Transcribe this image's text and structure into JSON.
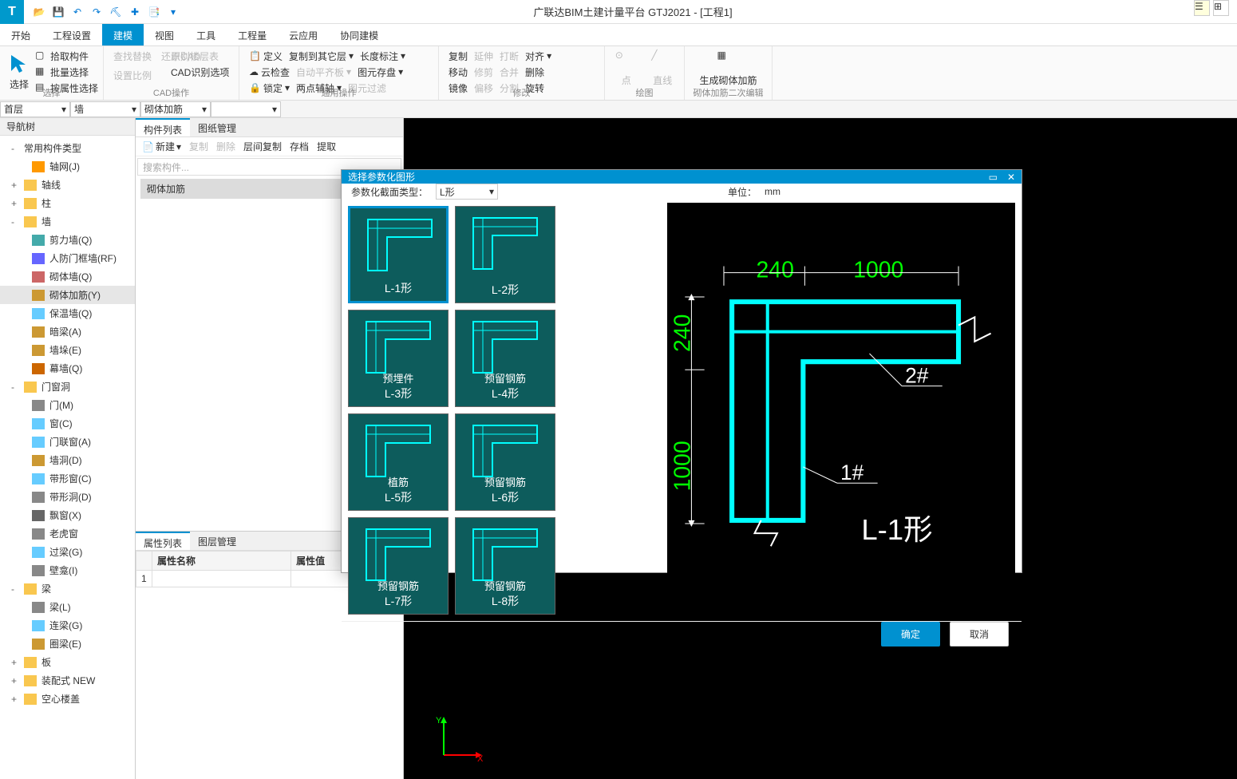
{
  "title": "广联达BIM土建计量平台 GTJ2021 - [工程1]",
  "tabs": [
    "开始",
    "工程设置",
    "建模",
    "视图",
    "工具",
    "工程量",
    "云应用",
    "协同建模"
  ],
  "active_tab": 2,
  "ribbon": {
    "select_group": {
      "big": "选择",
      "items": [
        "拾取构件",
        "批量选择",
        "按属性选择"
      ],
      "label": "选择"
    },
    "cad_group": {
      "items": [
        "查找替换",
        "识别楼层表",
        "定义",
        "设置比例",
        "CAD识别选项",
        "还原CAD"
      ],
      "label": "CAD操作"
    },
    "general_group": {
      "items": [
        "复制到其它层",
        "云检查",
        "自动平齐板",
        "锁定",
        "两点辅轴",
        "长度标注",
        "图元存盘",
        "图元过滤"
      ],
      "label": "通用操作"
    },
    "modify_group": {
      "items": [
        "复制",
        "延伸",
        "打断",
        "对齐",
        "移动",
        "修剪",
        "合并",
        "删除",
        "镜像",
        "偏移",
        "分割",
        "旋转"
      ],
      "label": "修改"
    },
    "draw_group": {
      "items": [
        "点",
        "直线"
      ],
      "label": "绘图"
    },
    "rebar_group": {
      "big": "生成砌体加筋",
      "label": "砌体加筋二次编辑"
    }
  },
  "floorsel": {
    "floor": "首层",
    "cat1": "墙",
    "cat2": "砌体加筋"
  },
  "nav": {
    "title": "导航树",
    "root": "常用构件类型",
    "items": [
      {
        "t": "轴网(J)",
        "lvl": 2,
        "ico": "#ff9900"
      },
      {
        "t": "轴线",
        "lvl": 1,
        "exp": "+"
      },
      {
        "t": "柱",
        "lvl": 1,
        "exp": "+"
      },
      {
        "t": "墙",
        "lvl": 1,
        "exp": "-"
      },
      {
        "t": "剪力墙(Q)",
        "lvl": 2,
        "ico": "#4aa"
      },
      {
        "t": "人防门框墙(RF)",
        "lvl": 2,
        "ico": "#66f"
      },
      {
        "t": "砌体墙(Q)",
        "lvl": 2,
        "ico": "#c66"
      },
      {
        "t": "砌体加筋(Y)",
        "lvl": 2,
        "ico": "#c93",
        "sel": true
      },
      {
        "t": "保温墙(Q)",
        "lvl": 2,
        "ico": "#6cf"
      },
      {
        "t": "暗梁(A)",
        "lvl": 2,
        "ico": "#c93"
      },
      {
        "t": "墙垛(E)",
        "lvl": 2,
        "ico": "#c93"
      },
      {
        "t": "幕墙(Q)",
        "lvl": 2,
        "ico": "#c60"
      },
      {
        "t": "门窗洞",
        "lvl": 1,
        "exp": "-"
      },
      {
        "t": "门(M)",
        "lvl": 2,
        "ico": "#888"
      },
      {
        "t": "窗(C)",
        "lvl": 2,
        "ico": "#6cf"
      },
      {
        "t": "门联窗(A)",
        "lvl": 2,
        "ico": "#6cf"
      },
      {
        "t": "墙洞(D)",
        "lvl": 2,
        "ico": "#c93"
      },
      {
        "t": "带形窗(C)",
        "lvl": 2,
        "ico": "#6cf"
      },
      {
        "t": "带形洞(D)",
        "lvl": 2,
        "ico": "#888"
      },
      {
        "t": "飘窗(X)",
        "lvl": 2,
        "ico": "#666"
      },
      {
        "t": "老虎窗",
        "lvl": 2,
        "ico": "#888"
      },
      {
        "t": "过梁(G)",
        "lvl": 2,
        "ico": "#6cf"
      },
      {
        "t": "壁龛(I)",
        "lvl": 2,
        "ico": "#888"
      },
      {
        "t": "梁",
        "lvl": 1,
        "exp": "-"
      },
      {
        "t": "梁(L)",
        "lvl": 2,
        "ico": "#888"
      },
      {
        "t": "连梁(G)",
        "lvl": 2,
        "ico": "#6cf"
      },
      {
        "t": "圈梁(E)",
        "lvl": 2,
        "ico": "#c93"
      },
      {
        "t": "板",
        "lvl": 1,
        "exp": "+"
      },
      {
        "t": "装配式 NEW",
        "lvl": 1,
        "exp": "+"
      },
      {
        "t": "空心楼盖",
        "lvl": 1,
        "exp": "+"
      }
    ]
  },
  "mid": {
    "tabs": [
      "构件列表",
      "图纸管理"
    ],
    "toolbar": [
      "新建",
      "复制",
      "删除",
      "层间复制",
      "存档",
      "提取"
    ],
    "search_ph": "搜索构件...",
    "component": "砌体加筋",
    "prop_tabs": [
      "属性列表",
      "图层管理"
    ],
    "prop_cols": [
      "属性名称",
      "属性值"
    ],
    "prop_rows": [
      [
        "",
        ""
      ]
    ]
  },
  "dialog": {
    "title": "选择参数化图形",
    "section_label": "参数化截面类型：",
    "section_type": "L形",
    "unit_label": "单位：",
    "unit": "mm",
    "thumbs": [
      {
        "name": "L-1形",
        "sel": true
      },
      {
        "name": "L-2形"
      },
      {
        "name": "L-3形",
        "tag": "预埋件"
      },
      {
        "name": "L-4形",
        "tag": "预留钢筋"
      },
      {
        "name": "L-5形",
        "tag": "植筋"
      },
      {
        "name": "L-6形",
        "tag": "预留钢筋"
      },
      {
        "name": "L-7形",
        "tag": "预留钢筋"
      },
      {
        "name": "L-8形",
        "tag": "预留钢筋"
      }
    ],
    "preview": {
      "dim1": "240",
      "dim2": "1000",
      "dim3": "240",
      "dim4": "1000",
      "lbl1": "1#",
      "lbl2": "2#",
      "name": "L-1形"
    },
    "ok": "确定",
    "cancel": "取消"
  },
  "axis": {
    "x": "X",
    "y": "Y"
  }
}
